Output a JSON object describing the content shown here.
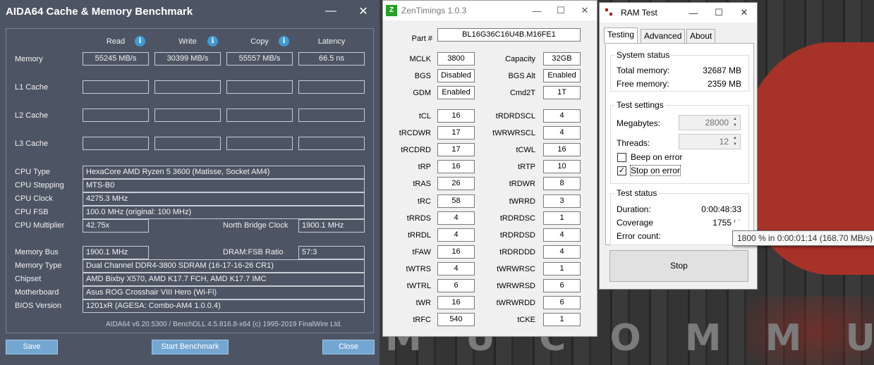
{
  "desktop": {
    "word": "M U C O M M U N I"
  },
  "aida": {
    "title": "AIDA64 Cache & Memory Benchmark",
    "headers": {
      "read": "Read",
      "write": "Write",
      "copy": "Copy",
      "latency": "Latency"
    },
    "rows": [
      {
        "label": "Memory",
        "read": "55245 MB/s",
        "write": "30399 MB/s",
        "copy": "55557 MB/s",
        "latency": "66.5 ns"
      },
      {
        "label": "L1 Cache",
        "read": "",
        "write": "",
        "copy": "",
        "latency": ""
      },
      {
        "label": "L2 Cache",
        "read": "",
        "write": "",
        "copy": "",
        "latency": ""
      },
      {
        "label": "L3 Cache",
        "read": "",
        "write": "",
        "copy": "",
        "latency": ""
      }
    ],
    "cpu_type": {
      "label": "CPU Type",
      "value": "HexaCore AMD Ryzen 5 3600  (Matisse, Socket AM4)"
    },
    "cpu_stepping": {
      "label": "CPU Stepping",
      "value": "MTS-B0"
    },
    "cpu_clock": {
      "label": "CPU Clock",
      "value": "4275.3 MHz"
    },
    "cpu_fsb": {
      "label": "CPU FSB",
      "value": "100.0 MHz  (original: 100 MHz)"
    },
    "cpu_multiplier": {
      "label": "CPU Multiplier",
      "value": "42.75x"
    },
    "nb_clock": {
      "label": "North Bridge Clock",
      "value": "1900.1 MHz"
    },
    "memory_bus": {
      "label": "Memory Bus",
      "value": "1900.1 MHz"
    },
    "dram_fsb": {
      "label": "DRAM:FSB Ratio",
      "value": "57:3"
    },
    "memory_type": {
      "label": "Memory Type",
      "value": "Dual Channel DDR4-3800 SDRAM  (16-17-16-26 CR1)"
    },
    "chipset": {
      "label": "Chipset",
      "value": "AMD Bixby X570, AMD K17.7 FCH, AMD K17.7 IMC"
    },
    "motherboard": {
      "label": "Motherboard",
      "value": "Asus ROG Crosshair VIII Hero (Wi-Fi)"
    },
    "bios": {
      "label": "BIOS Version",
      "value": "1201xR  (AGESA: Combo-AM4 1.0.0.4)"
    },
    "footer": "AIDA64 v6.20.5300 / BenchDLL 4.5.816.8-x64  (c) 1995-2019 FinalWire Ltd.",
    "buttons": {
      "save": "Save",
      "start": "Start Benchmark",
      "close": "Close"
    }
  },
  "zen": {
    "title": "ZenTimings 1.0.3",
    "part_label": "Part #",
    "part_value": "BL16G36C16U4B.M16FE1",
    "top": [
      {
        "l": "MCLK",
        "v": "3800",
        "l2": "Capacity",
        "v2": "32GB"
      },
      {
        "l": "BGS",
        "v": "Disabled",
        "l2": "BGS Alt",
        "v2": "Enabled"
      },
      {
        "l": "GDM",
        "v": "Enabled",
        "l2": "Cmd2T",
        "v2": "1T"
      }
    ],
    "timings": [
      {
        "l": "tCL",
        "v": "16",
        "l2": "tRDRDSCL",
        "v2": "4"
      },
      {
        "l": "tRCDWR",
        "v": "17",
        "l2": "tWRWRSCL",
        "v2": "4"
      },
      {
        "l": "tRCDRD",
        "v": "17",
        "l2": "tCWL",
        "v2": "16"
      },
      {
        "l": "tRP",
        "v": "16",
        "l2": "tRTP",
        "v2": "10"
      },
      {
        "l": "tRAS",
        "v": "26",
        "l2": "tRDWR",
        "v2": "8"
      },
      {
        "l": "tRC",
        "v": "58",
        "l2": "tWRRD",
        "v2": "3"
      },
      {
        "l": "tRRDS",
        "v": "4",
        "l2": "tRDRDSC",
        "v2": "1"
      },
      {
        "l": "tRRDL",
        "v": "4",
        "l2": "tRDRDSD",
        "v2": "4"
      },
      {
        "l": "tFAW",
        "v": "16",
        "l2": "tRDRDDD",
        "v2": "4"
      },
      {
        "l": "tWTRS",
        "v": "4",
        "l2": "tWRWRSC",
        "v2": "1"
      },
      {
        "l": "tWTRL",
        "v": "6",
        "l2": "tWRWRSD",
        "v2": "6"
      },
      {
        "l": "tWR",
        "v": "16",
        "l2": "tWRWRDD",
        "v2": "6"
      },
      {
        "l": "tRFC",
        "v": "540",
        "l2": "tCKE",
        "v2": "1"
      }
    ]
  },
  "ram": {
    "title": "RAM Test",
    "tabs": [
      "Testing",
      "Advanced",
      "About"
    ],
    "system_status": {
      "title": "System status",
      "total_label": "Total memory:",
      "total_value": "32687 MB",
      "free_label": "Free memory:",
      "free_value": "2359 MB"
    },
    "test_settings": {
      "title": "Test settings",
      "mb_label": "Megabytes:",
      "mb_value": "28000",
      "threads_label": "Threads:",
      "threads_value": "12",
      "beep_label": "Beep on error",
      "beep_checked": false,
      "stop_label": "Stop on error",
      "stop_checked": true
    },
    "test_status": {
      "title": "Test status",
      "duration_label": "Duration:",
      "duration_value": "0:00:48:33",
      "coverage_label": "Coverage",
      "coverage_value": "1755 %",
      "errors_label": "Error count:",
      "errors_value": ""
    },
    "stop_button": "Stop",
    "tooltip": "1800 % in 0:00:01:14 (168.70 MB/s)"
  }
}
